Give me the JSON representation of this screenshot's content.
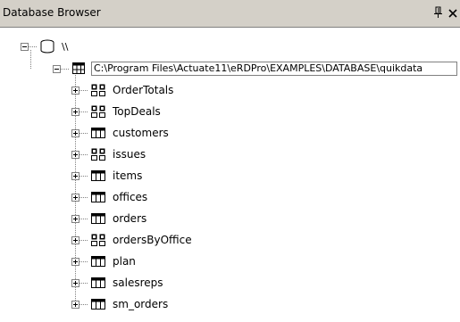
{
  "window": {
    "title": "Database Browser",
    "pin_glyph": "ꟼ",
    "close_glyph": "✕"
  },
  "tree": {
    "root_label": "\\\\",
    "connection_path": "C:\\Program Files\\Actuate11\\eRDPro\\EXAMPLES\\DATABASE\\quikdata",
    "items": [
      {
        "label": "OrderTotals",
        "type": "view"
      },
      {
        "label": "TopDeals",
        "type": "view"
      },
      {
        "label": "customers",
        "type": "table"
      },
      {
        "label": "issues",
        "type": "view"
      },
      {
        "label": "items",
        "type": "table"
      },
      {
        "label": "offices",
        "type": "table"
      },
      {
        "label": "orders",
        "type": "table"
      },
      {
        "label": "ordersByOffice",
        "type": "view"
      },
      {
        "label": "plan",
        "type": "table"
      },
      {
        "label": "salesreps",
        "type": "table"
      },
      {
        "label": "sm_orders",
        "type": "table"
      }
    ]
  }
}
